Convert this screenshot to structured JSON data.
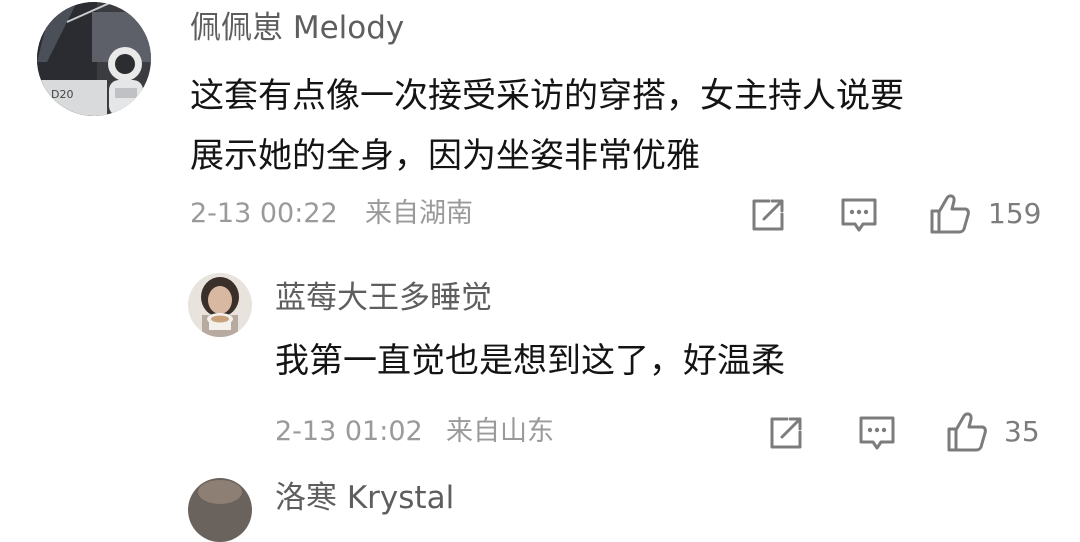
{
  "comments": [
    {
      "author": "佩佩崽 Melody",
      "lines": [
        "这套有点像一次接受采访的穿搭，女主持人说要",
        "展示她的全身，因为坐姿非常优雅"
      ],
      "timestamp": "2-13 00:22",
      "location": "来自湖南",
      "likes": "159",
      "avatar_icon": "astronaut-avatar"
    },
    {
      "author": "蓝莓大王多睡觉",
      "lines": [
        "我第一直觉也是想到这了，好温柔"
      ],
      "timestamp": "2-13 01:02",
      "location": "来自山东",
      "likes": "35",
      "avatar_icon": "woman-coffee-avatar"
    },
    {
      "author": "洛寒 Krystal",
      "avatar_icon": "partial-avatar"
    }
  ],
  "icons": {
    "share": "share-icon",
    "reply": "comment-icon",
    "like": "thumbs-up-icon"
  },
  "colors": {
    "name": "#5e5e5e",
    "body": "#141414",
    "meta": "#9a9a9a",
    "icon": "#7c7c7c"
  }
}
